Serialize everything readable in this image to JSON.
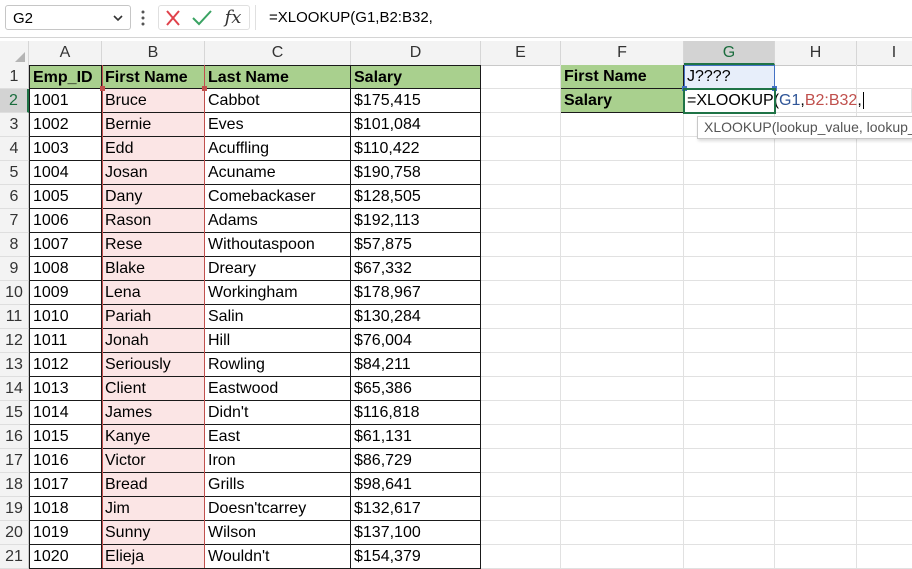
{
  "formula_bar": {
    "name_box": "G2",
    "fx_label": "fx",
    "formula": "=XLOOKUP(G1,B2:B32,"
  },
  "columns": [
    "A",
    "B",
    "C",
    "D",
    "E",
    "F",
    "G",
    "H",
    "I"
  ],
  "selected_column": "G",
  "selected_row": 2,
  "table": {
    "headers": [
      "Emp_ID",
      "First Name",
      "Last Name",
      "Salary"
    ],
    "rows": [
      {
        "row": 1,
        "id": "Emp_ID",
        "first": "First Name",
        "last": "Last Name",
        "salary": "Salary"
      },
      {
        "row": 2,
        "id": "1001",
        "first": "Bruce",
        "last": "Cabbot",
        "salary": "$175,415"
      },
      {
        "row": 3,
        "id": "1002",
        "first": "Bernie",
        "last": "Eves",
        "salary": "$101,084"
      },
      {
        "row": 4,
        "id": "1003",
        "first": "Edd",
        "last": "Acuffling",
        "salary": "$110,422"
      },
      {
        "row": 5,
        "id": "1004",
        "first": "Josan",
        "last": "Acuname",
        "salary": "$190,758"
      },
      {
        "row": 6,
        "id": "1005",
        "first": "Dany",
        "last": "Comebackaser",
        "salary": "$128,505"
      },
      {
        "row": 7,
        "id": "1006",
        "first": "Rason",
        "last": "Adams",
        "salary": "$192,113"
      },
      {
        "row": 8,
        "id": "1007",
        "first": "Rese",
        "last": "Withoutaspoon",
        "salary": "$57,875"
      },
      {
        "row": 9,
        "id": "1008",
        "first": "Blake",
        "last": "Dreary",
        "salary": "$67,332"
      },
      {
        "row": 10,
        "id": "1009",
        "first": "Lena",
        "last": "Workingham",
        "salary": "$178,967"
      },
      {
        "row": 11,
        "id": "1010",
        "first": "Pariah",
        "last": "Salin",
        "salary": "$130,284"
      },
      {
        "row": 12,
        "id": "1011",
        "first": "Jonah",
        "last": "Hill",
        "salary": "$76,004"
      },
      {
        "row": 13,
        "id": "1012",
        "first": "Seriously",
        "last": "Rowling",
        "salary": "$84,211"
      },
      {
        "row": 14,
        "id": "1013",
        "first": "Client",
        "last": "Eastwood",
        "salary": "$65,386"
      },
      {
        "row": 15,
        "id": "1014",
        "first": "James",
        "last": "Didn't",
        "salary": "$116,818"
      },
      {
        "row": 16,
        "id": "1015",
        "first": "Kanye",
        "last": "East",
        "salary": "$61,131"
      },
      {
        "row": 17,
        "id": "1016",
        "first": "Victor",
        "last": "Iron",
        "salary": "$86,729"
      },
      {
        "row": 18,
        "id": "1017",
        "first": "Bread",
        "last": "Grills",
        "salary": "$98,641"
      },
      {
        "row": 19,
        "id": "1018",
        "first": "Jim",
        "last": "Doesn'tcarrey",
        "salary": "$132,617"
      },
      {
        "row": 20,
        "id": "1019",
        "first": "Sunny",
        "last": "Wilson",
        "salary": "$137,100"
      },
      {
        "row": 21,
        "id": "1020",
        "first": "Elieja",
        "last": "Wouldn't",
        "salary": "$154,379"
      }
    ]
  },
  "lookup": {
    "label_first_name": "First Name",
    "label_salary": "Salary",
    "g1_value": "J????",
    "g2_formula_prefix": "=XLOOKUP(",
    "g2_ref_g1": "G1",
    "g2_sep1": ",",
    "g2_ref_range": "B2:B32",
    "g2_sep2": ","
  },
  "tooltip": "XLOOKUP(lookup_value, lookup_array,",
  "colors": {
    "header_green": "#a9d08e",
    "range_pink": "#fbe5e5",
    "range_red": "#c0504d",
    "ref_blue": "#4472c4",
    "active_green": "#1f7346"
  }
}
